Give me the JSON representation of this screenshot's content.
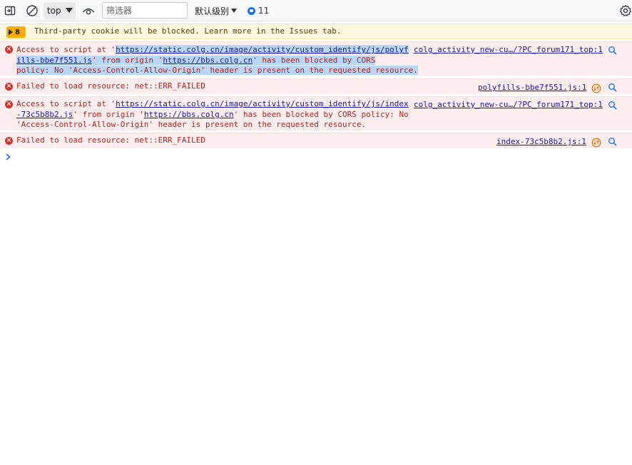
{
  "toolbar": {
    "context": "top",
    "filter_placeholder": "筛选器",
    "filter_value": "",
    "levels_label": "默认级别",
    "issues_count": "11"
  },
  "banner": {
    "count": "8",
    "text": "Third-party cookie will be blocked. Learn more in the Issues tab."
  },
  "messages": [
    {
      "l1_pre": "Access to script at '",
      "l1_link": "https://static.colg.cn/image/activity/custom_identify/js/polyf",
      "l2_link": "ills-bbe7f551.js",
      "l2_mid": "' from origin '",
      "l2_link2": "https://bbs.colg.cn",
      "l2_post": "' has been blocked by CORS",
      "l3": "policy: No 'Access-Control-Allow-Origin' header is present on the requested resource.",
      "source": "colg_activity_new-cu…/?PC_forum171_top:1"
    },
    {
      "text": "Failed to load resource: net::ERR_FAILED",
      "source": "polyfills-bbe7f551.js:1"
    },
    {
      "l1_pre": "Access to script at '",
      "l1_link": "https://static.colg.cn/image/activity/custom_identify/js/index",
      "l2_link": "-73c5b8b2.js",
      "l2_mid": "' from origin '",
      "l2_link2": "https://bbs.colg.cn",
      "l2_post": "' has been blocked by CORS policy: No",
      "l3": "'Access-Control-Allow-Origin' header is present on the requested resource.",
      "source": "colg_activity_new-cu…/?PC_forum171_top:1"
    },
    {
      "text": "Failed to load resource: net::ERR_FAILED",
      "source": "index-73c5b8b2.js:1"
    }
  ],
  "colors": {
    "error_bg": "#fceeee",
    "error_text": "#b3261e",
    "warning_bg": "#fef7e0",
    "link": "#1a1aa6",
    "selection": "#b9d6f7",
    "accent": "#1a73e8"
  },
  "icons": [
    "dock-side-icon",
    "clear-console-icon",
    "live-expression-eye-icon",
    "settings-gear-icon",
    "error-icon",
    "network-icon",
    "search-icon",
    "prompt-chevron-icon"
  ]
}
